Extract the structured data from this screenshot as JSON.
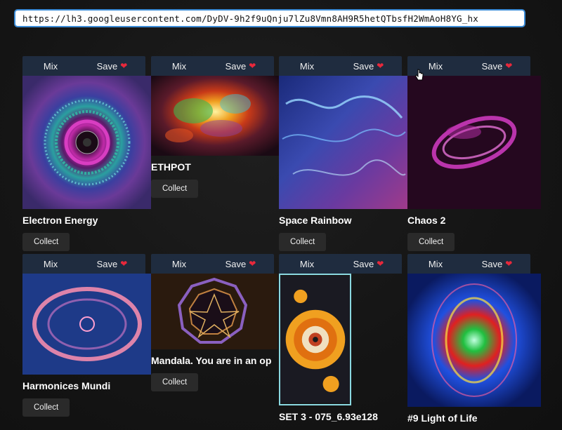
{
  "address_bar": {
    "url": "https://lh3.googleusercontent.com/DyDV-9h2f9uQnju7lZu8Vmn8AH9R5hetQTbsfH2WmAoH8YG_hx"
  },
  "labels": {
    "mix": "Mix",
    "save": "Save",
    "collect": "Collect"
  },
  "colors": {
    "card_header": "#1f2c3f",
    "heart": "#e8283b",
    "collect_button": "#2a2a2a"
  },
  "cards": [
    {
      "title": "Electron Energy"
    },
    {
      "title": "ETHPOT"
    },
    {
      "title": "Space Rainbow"
    },
    {
      "title": "Chaos 2"
    },
    {
      "title": "Harmonices Mundi"
    },
    {
      "title": "Mandala. You are in an op"
    },
    {
      "title": "SET 3 - 075_6.93e128"
    },
    {
      "title": "#9 Light of Life"
    }
  ]
}
